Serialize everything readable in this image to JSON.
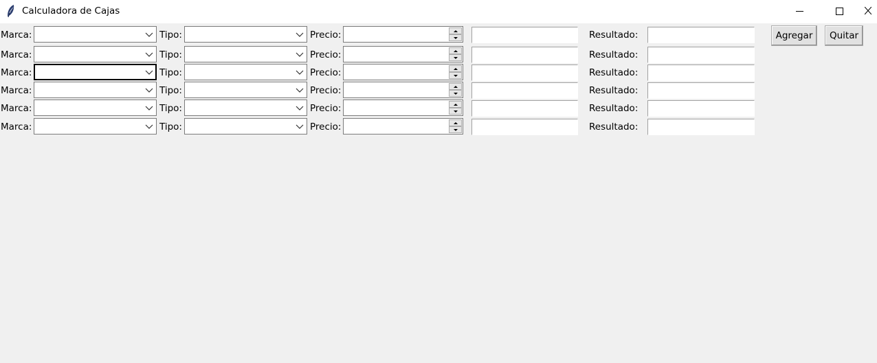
{
  "window": {
    "title": "Calculadora de Cajas",
    "icon": "feather-icon"
  },
  "labels": {
    "marca": "Marca:",
    "tipo": "Tipo:",
    "precio": "Precio:",
    "resultado": "Resultado:"
  },
  "buttons": {
    "agregar": "Agregar",
    "quitar": "Quitar"
  },
  "rows": [
    {
      "marca": "",
      "tipo": "",
      "precio": "",
      "calculo": "",
      "resultado": ""
    },
    {
      "marca": "",
      "tipo": "",
      "precio": "",
      "calculo": "",
      "resultado": ""
    },
    {
      "marca": "",
      "tipo": "",
      "precio": "",
      "calculo": "",
      "resultado": "",
      "focused": "marca"
    },
    {
      "marca": "",
      "tipo": "",
      "precio": "",
      "calculo": "",
      "resultado": ""
    },
    {
      "marca": "",
      "tipo": "",
      "precio": "",
      "calculo": "",
      "resultado": ""
    },
    {
      "marca": "",
      "tipo": "",
      "precio": "",
      "calculo": "",
      "resultado": ""
    }
  ],
  "colors": {
    "window_bg": "#f0f0f0",
    "titlebar_bg": "#ffffff"
  }
}
